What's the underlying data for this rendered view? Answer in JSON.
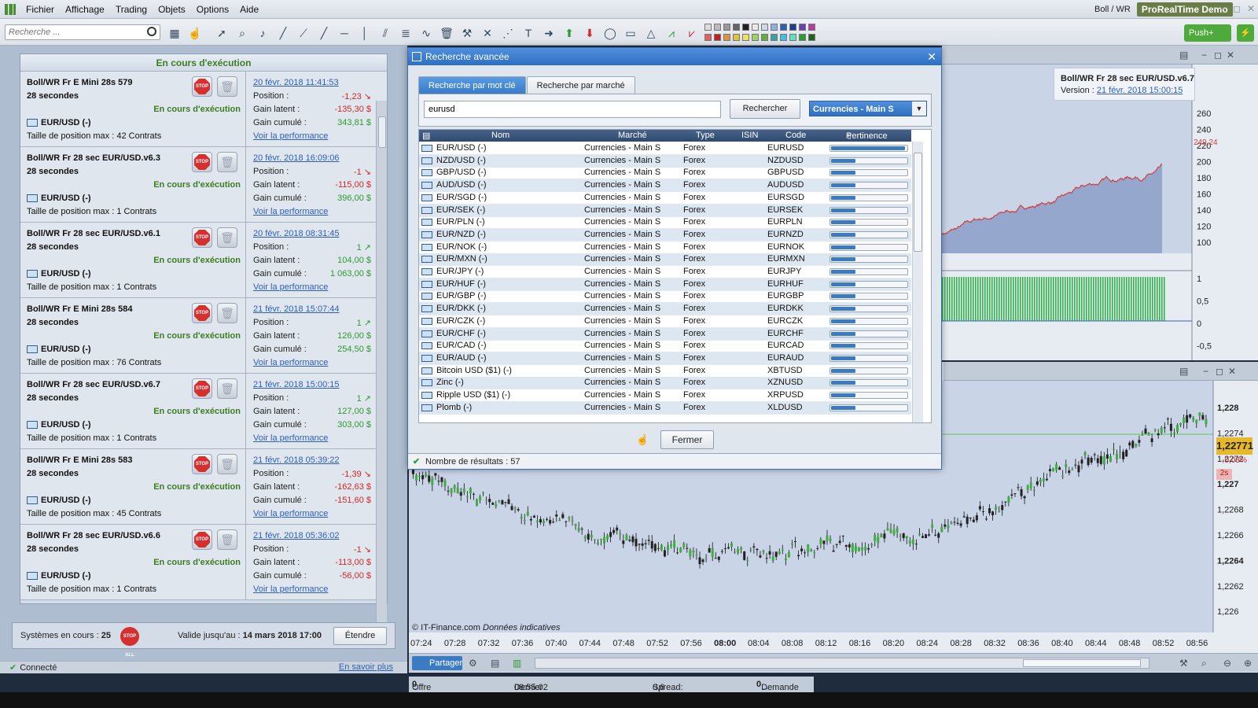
{
  "menu": {
    "items": [
      "Fichier",
      "Affichage",
      "Trading",
      "Objets",
      "Options",
      "Aide"
    ]
  },
  "brand": {
    "account": "Boll / WR",
    "product": "ProRealTime",
    "mode": "Demo"
  },
  "toolbar": {
    "search_placeholder": "Recherche ...",
    "push_label": "Push+"
  },
  "left_panel": {
    "header": "En cours d'exécution",
    "systems": [
      {
        "name": "Boll/WR Fr E Mini 28s 579",
        "period": "28 secondes",
        "status": "En cours d'exécution",
        "instrument": "EUR/USD (-)",
        "size": "Taille de position max : 42 Contrats",
        "date": "20 févr. 2018 11:41:53",
        "position": "-1,23",
        "latent": "-135,30 $",
        "cumul": "343,81 $",
        "perf": "Voir la performance"
      },
      {
        "name": "Boll/WR Fr 28 sec EUR/USD.v6.3",
        "period": "28 secondes",
        "status": "En cours d'exécution",
        "instrument": "EUR/USD (-)",
        "size": "Taille de position max : 1 Contrats",
        "date": "20 févr. 2018 16:09:06",
        "position": "-1",
        "latent": "-115,00 $",
        "cumul": "396,00 $",
        "perf": "Voir la performance"
      },
      {
        "name": "Boll/WR Fr 28 sec EUR/USD.v6.1",
        "period": "28 secondes",
        "status": "En cours d'exécution",
        "instrument": "EUR/USD (-)",
        "size": "Taille de position max : 1 Contrats",
        "date": "20 févr. 2018 08:31:45",
        "position": "1",
        "latent": "104,00 $",
        "cumul": "1 063,00 $",
        "perf": "Voir la performance"
      },
      {
        "name": "Boll/WR Fr E Mini 28s 584",
        "period": "28 secondes",
        "status": "En cours d'exécution",
        "instrument": "EUR/USD (-)",
        "size": "Taille de position max : 76 Contrats",
        "date": "21 févr. 2018 15:07:44",
        "position": "1",
        "latent": "126,00 $",
        "cumul": "254,50 $",
        "perf": "Voir la performance"
      },
      {
        "name": "Boll/WR Fr 28 sec EUR/USD.v6.7",
        "period": "28 secondes",
        "status": "En cours d'exécution",
        "instrument": "EUR/USD (-)",
        "size": "Taille de position max : 1 Contrats",
        "date": "21 févr. 2018 15:00:15",
        "position": "1",
        "latent": "127,00 $",
        "cumul": "303,00 $",
        "perf": "Voir la performance"
      },
      {
        "name": "Boll/WR Fr E Mini 28s 583",
        "period": "28 secondes",
        "status": "En cours d'exécution",
        "instrument": "EUR/USD (-)",
        "size": "Taille de position max : 45 Contrats",
        "date": "21 févr. 2018 05:39:22",
        "position": "-1,39",
        "latent": "-162,63 $",
        "cumul": "-151,60 $",
        "perf": "Voir la performance"
      },
      {
        "name": "Boll/WR Fr 28 sec EUR/USD.v6.6",
        "period": "28 secondes",
        "status": "En cours d'exécution",
        "instrument": "EUR/USD (-)",
        "size": "Taille de position max : 1 Contrats",
        "date": "21 févr. 2018 05:36:02",
        "position": "-1",
        "latent": "-113,00 $",
        "cumul": "-56,00 $",
        "perf": "Voir la performance"
      }
    ],
    "labels": {
      "position": "Position :",
      "latent": "Gain latent :",
      "cumul": "Gain cumulé :",
      "stop": "STOP"
    },
    "footer": {
      "systems_label": "Systèmes en cours :",
      "systems_count": "25",
      "valid_label": "Valide jusqu'au :",
      "valid_date": "14 mars 2018 17:00",
      "extend_button": "Étendre",
      "stop_all": "STOP ALL"
    },
    "status": {
      "connected": "Connecté",
      "learn_more": "En savoir plus"
    }
  },
  "dialog": {
    "title": "Recherche avancée",
    "tabs": [
      "Recherche par mot clé",
      "Recherche par marché"
    ],
    "query": "eurusd",
    "search_button": "Rechercher",
    "market_select": "Currencies - Main S",
    "columns": {
      "name": "Nom",
      "market": "Marché",
      "type": "Type",
      "isin": "ISIN",
      "code": "Code",
      "relevance": "Pertinence"
    },
    "results": [
      {
        "name": "EUR/USD (-)",
        "market": "Currencies - Main S",
        "type": "Forex",
        "code": "EURUSD",
        "relevance": 0.98
      },
      {
        "name": "NZD/USD (-)",
        "market": "Currencies - Main S",
        "type": "Forex",
        "code": "NZDUSD",
        "relevance": 0.32
      },
      {
        "name": "GBP/USD (-)",
        "market": "Currencies - Main S",
        "type": "Forex",
        "code": "GBPUSD",
        "relevance": 0.32
      },
      {
        "name": "AUD/USD (-)",
        "market": "Currencies - Main S",
        "type": "Forex",
        "code": "AUDUSD",
        "relevance": 0.32
      },
      {
        "name": "EUR/SGD (-)",
        "market": "Currencies - Main S",
        "type": "Forex",
        "code": "EURSGD",
        "relevance": 0.32
      },
      {
        "name": "EUR/SEK (-)",
        "market": "Currencies - Main S",
        "type": "Forex",
        "code": "EURSEK",
        "relevance": 0.32
      },
      {
        "name": "EUR/PLN (-)",
        "market": "Currencies - Main S",
        "type": "Forex",
        "code": "EURPLN",
        "relevance": 0.32
      },
      {
        "name": "EUR/NZD (-)",
        "market": "Currencies - Main S",
        "type": "Forex",
        "code": "EURNZD",
        "relevance": 0.32
      },
      {
        "name": "EUR/NOK (-)",
        "market": "Currencies - Main S",
        "type": "Forex",
        "code": "EURNOK",
        "relevance": 0.32
      },
      {
        "name": "EUR/MXN (-)",
        "market": "Currencies - Main S",
        "type": "Forex",
        "code": "EURMXN",
        "relevance": 0.32
      },
      {
        "name": "EUR/JPY (-)",
        "market": "Currencies - Main S",
        "type": "Forex",
        "code": "EURJPY",
        "relevance": 0.32
      },
      {
        "name": "EUR/HUF (-)",
        "market": "Currencies - Main S",
        "type": "Forex",
        "code": "EURHUF",
        "relevance": 0.32
      },
      {
        "name": "EUR/GBP (-)",
        "market": "Currencies - Main S",
        "type": "Forex",
        "code": "EURGBP",
        "relevance": 0.32
      },
      {
        "name": "EUR/DKK (-)",
        "market": "Currencies - Main S",
        "type": "Forex",
        "code": "EURDKK",
        "relevance": 0.32
      },
      {
        "name": "EUR/CZK (-)",
        "market": "Currencies - Main S",
        "type": "Forex",
        "code": "EURCZK",
        "relevance": 0.32
      },
      {
        "name": "EUR/CHF (-)",
        "market": "Currencies - Main S",
        "type": "Forex",
        "code": "EURCHF",
        "relevance": 0.32
      },
      {
        "name": "EUR/CAD (-)",
        "market": "Currencies - Main S",
        "type": "Forex",
        "code": "EURCAD",
        "relevance": 0.32
      },
      {
        "name": "EUR/AUD (-)",
        "market": "Currencies - Main S",
        "type": "Forex",
        "code": "EURAUD",
        "relevance": 0.32
      },
      {
        "name": "Bitcoin USD ($1) (-)",
        "market": "Currencies - Main S",
        "type": "Forex",
        "code": "XBTUSD",
        "relevance": 0.32
      },
      {
        "name": "Zinc (-)",
        "market": "Currencies - Main S",
        "type": "Forex",
        "code": "XZNUSD",
        "relevance": 0.32
      },
      {
        "name": "Ripple USD ($1) (-)",
        "market": "Currencies - Main S",
        "type": "Forex",
        "code": "XRPUSD",
        "relevance": 0.32
      },
      {
        "name": "Plomb (-)",
        "market": "Currencies - Main S",
        "type": "Forex",
        "code": "XLDUSD",
        "relevance": 0.32
      }
    ],
    "close_button": "Fermer",
    "result_count_label": "Nombre de résultats : 57"
  },
  "chart_top": {
    "system_name": "Boll/WR Fr 28 sec EUR/USD.v6.7",
    "version_label": "Version :",
    "version_date": "21 févr. 2018 15:00:15",
    "last_value": "249,24",
    "y_ticks": [
      "260",
      "240",
      "220",
      "200",
      "180",
      "160",
      "140",
      "120",
      "100"
    ],
    "y_ticks_osc": [
      "1",
      "0,5",
      "0",
      "-0,5",
      "-1"
    ]
  },
  "chart_main": {
    "source": "© IT-Finance.com",
    "source_note": "Données indicatives",
    "price": "1,22771",
    "change": "-0,03%",
    "timer": "2s",
    "y_ticks": [
      "1,228",
      "1,2274",
      "1,2272",
      "1,227",
      "1,2268",
      "1,2266",
      "1,2264",
      "1,2262",
      "1,226"
    ],
    "x_ticks": [
      "07:24",
      "07:28",
      "07:32",
      "07:36",
      "07:40",
      "07:44",
      "07:48",
      "07:52",
      "07:56",
      "08:00",
      "08:04",
      "08:08",
      "08:12",
      "08:16",
      "08:20",
      "08:24",
      "08:28",
      "08:32",
      "08:36",
      "08:40",
      "08:44",
      "08:48",
      "08:52",
      "08:56"
    ]
  },
  "chart_toolbar": {
    "share_label": "Partager"
  },
  "ticker": {
    "offer_label": "Offre",
    "offer_value": "0",
    "last_label": "Dernier :",
    "last_value": "08:55:02",
    "spread_label": "Spread:",
    "spread_value": "0,6",
    "ask_value": "0",
    "ask_label": "Demande"
  },
  "colors": {
    "accent": "#2f6fc0",
    "running": "#3d7d22",
    "loss": "#d02828",
    "gain": "#2f9a2f"
  }
}
